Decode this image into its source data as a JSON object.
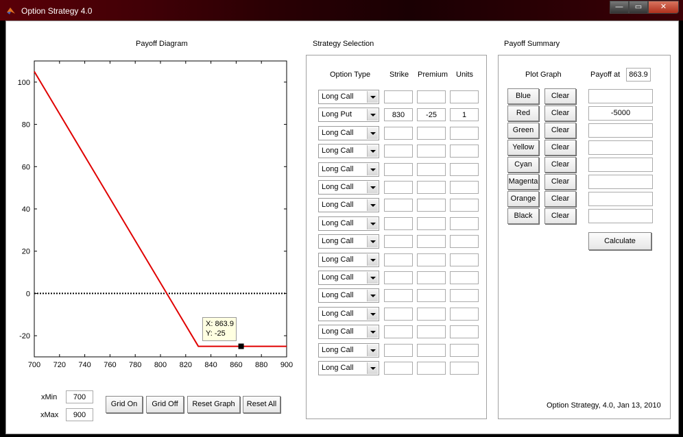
{
  "window": {
    "title": "Option Strategy 4.0",
    "minimize": "—",
    "maximize": "▭",
    "close": "✕"
  },
  "payoff_diagram": {
    "title": "Payoff Diagram",
    "xmin_label": "xMin",
    "xmin_value": "700",
    "xmax_label": "xMax",
    "xmax_value": "900",
    "datatip_x": "X: 863.9",
    "datatip_y": "Y: -25",
    "buttons": {
      "grid_on": "Grid On",
      "grid_off": "Grid Off",
      "reset_graph": "Reset Graph",
      "reset_all": "Reset All"
    }
  },
  "chart_data": {
    "type": "line",
    "title": "Payoff Diagram",
    "xlim": [
      700,
      900
    ],
    "ylim": [
      -30,
      110
    ],
    "xticks": [
      "700",
      "720",
      "740",
      "760",
      "780",
      "800",
      "820",
      "840",
      "860",
      "880",
      "900"
    ],
    "yticks": [
      "100",
      "80",
      "60",
      "40",
      "20",
      "0",
      "-20"
    ],
    "series": [
      {
        "color": "#e00000",
        "x": [
          700,
          830,
          900
        ],
        "y": [
          105,
          -25,
          -25
        ]
      }
    ],
    "zero_line": {
      "y": 0,
      "style": "dotted",
      "color": "#000000"
    },
    "marker": {
      "x": 863.9,
      "y": -25
    }
  },
  "strategy": {
    "title": "Strategy Selection",
    "headers": {
      "type": "Option Type",
      "strike": "Strike",
      "premium": "Premium",
      "units": "Units"
    },
    "rows": [
      {
        "type": "Long Call",
        "strike": "",
        "premium": "",
        "units": ""
      },
      {
        "type": "Long Put",
        "strike": "830",
        "premium": "-25",
        "units": "1"
      },
      {
        "type": "Long Call",
        "strike": "",
        "premium": "",
        "units": ""
      },
      {
        "type": "Long Call",
        "strike": "",
        "premium": "",
        "units": ""
      },
      {
        "type": "Long Call",
        "strike": "",
        "premium": "",
        "units": ""
      },
      {
        "type": "Long Call",
        "strike": "",
        "premium": "",
        "units": ""
      },
      {
        "type": "Long Call",
        "strike": "",
        "premium": "",
        "units": ""
      },
      {
        "type": "Long Call",
        "strike": "",
        "premium": "",
        "units": ""
      },
      {
        "type": "Long Call",
        "strike": "",
        "premium": "",
        "units": ""
      },
      {
        "type": "Long Call",
        "strike": "",
        "premium": "",
        "units": ""
      },
      {
        "type": "Long Call",
        "strike": "",
        "premium": "",
        "units": ""
      },
      {
        "type": "Long Call",
        "strike": "",
        "premium": "",
        "units": ""
      },
      {
        "type": "Long Call",
        "strike": "",
        "premium": "",
        "units": ""
      },
      {
        "type": "Long Call",
        "strike": "",
        "premium": "",
        "units": ""
      },
      {
        "type": "Long Call",
        "strike": "",
        "premium": "",
        "units": ""
      },
      {
        "type": "Long Call",
        "strike": "",
        "premium": "",
        "units": ""
      }
    ]
  },
  "summary": {
    "title": "Payoff Summary",
    "plot_graph_label": "Plot Graph",
    "payoff_at_label": "Payoff at",
    "payoff_at_value": "863.9",
    "clear_label": "Clear",
    "rows": [
      {
        "color": "Blue",
        "value": ""
      },
      {
        "color": "Red",
        "value": "-5000"
      },
      {
        "color": "Green",
        "value": ""
      },
      {
        "color": "Yellow",
        "value": ""
      },
      {
        "color": "Cyan",
        "value": ""
      },
      {
        "color": "Magenta",
        "value": ""
      },
      {
        "color": "Orange",
        "value": ""
      },
      {
        "color": "Black",
        "value": ""
      }
    ],
    "calculate": "Calculate",
    "footer": "Option Strategy, 4.0, Jan 13, 2010"
  }
}
